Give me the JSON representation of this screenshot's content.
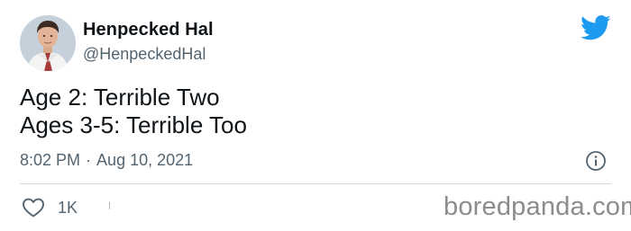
{
  "author": {
    "display_name": "Henpecked Hal",
    "handle": "@HenpeckedHal",
    "avatar_icon": "profile-photo"
  },
  "tweet": {
    "lines": [
      "Age 2: Terrible Two",
      "Ages 3-5: Terrible Too"
    ],
    "time": "8:02 PM",
    "separator": "·",
    "date": "Aug 10, 2021"
  },
  "actions": {
    "like_icon": "heart-outline-icon",
    "like_count": "1K"
  },
  "branding": {
    "platform_icon": "twitter-bird-icon",
    "watermark": "boredpanda.com"
  },
  "colors": {
    "twitter_blue": "#1d9bf0",
    "secondary_text": "#536471",
    "primary_text": "#0f1419",
    "divider": "#cfd9de",
    "watermark": "#8c8c8c"
  }
}
